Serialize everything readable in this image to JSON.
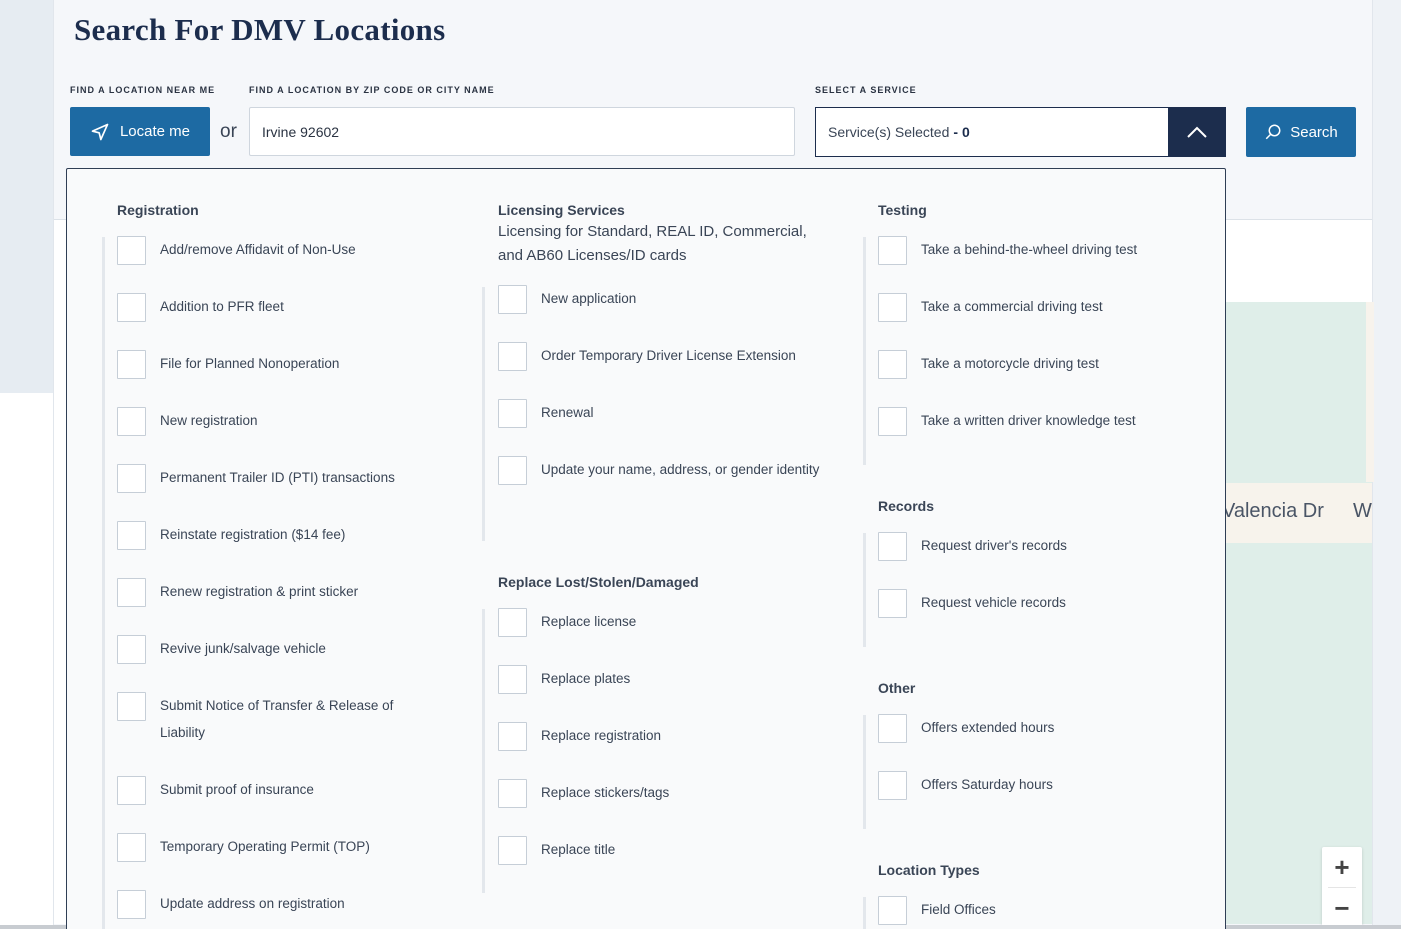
{
  "header": {
    "title": "Search For DMV Locations",
    "label_near_me": "FIND A LOCATION NEAR ME",
    "label_zip": "FIND A LOCATION BY ZIP CODE OR CITY NAME",
    "label_service": "SELECT A SERVICE",
    "locate_button": "Locate me",
    "or_text": "or",
    "zip_value": "Irvine 92602",
    "service_selected_label": "Service(s) Selected",
    "service_selected_count": "- 0",
    "search_button": "Search"
  },
  "map": {
    "street_label": "Valencia Dr",
    "street_label2": "W",
    "zoom_in": "+",
    "zoom_out": "−"
  },
  "registration": {
    "title": "Registration",
    "items": [
      "Add/remove Affidavit of Non-Use",
      "Addition to PFR fleet",
      "File for Planned Nonoperation",
      "New registration",
      "Permanent Trailer ID (PTI) transactions",
      "Reinstate registration ($14 fee)",
      "Renew registration & print sticker",
      "Revive junk/salvage vehicle",
      "Submit Notice of Transfer & Release of Liability",
      "Submit proof of insurance",
      "Temporary Operating Permit (TOP)",
      "Update address on registration"
    ]
  },
  "licensing": {
    "title": "Licensing Services",
    "subtitle": "Licensing for Standard, REAL ID, Commercial, and AB60 Licenses/ID cards",
    "items": [
      "New application",
      "Order Temporary Driver License Extension",
      "Renewal",
      "Update your name, address, or gender identity"
    ]
  },
  "replace": {
    "title": "Replace Lost/Stolen/Damaged",
    "items": [
      "Replace license",
      "Replace plates",
      "Replace registration",
      "Replace stickers/tags",
      "Replace title"
    ]
  },
  "testing": {
    "title": "Testing",
    "items": [
      "Take a behind-the-wheel driving test",
      "Take a commercial driving test",
      "Take a motorcycle driving test",
      "Take a written driver knowledge test"
    ]
  },
  "records": {
    "title": "Records",
    "items": [
      "Request driver's records",
      "Request vehicle records"
    ]
  },
  "other": {
    "title": "Other",
    "items": [
      "Offers extended hours",
      "Offers Saturday hours"
    ]
  },
  "location_types": {
    "title": "Location Types",
    "items": [
      "Field Offices"
    ]
  },
  "colors": {
    "primary": "#1d6aa3",
    "navy": "#1c2d4d"
  }
}
